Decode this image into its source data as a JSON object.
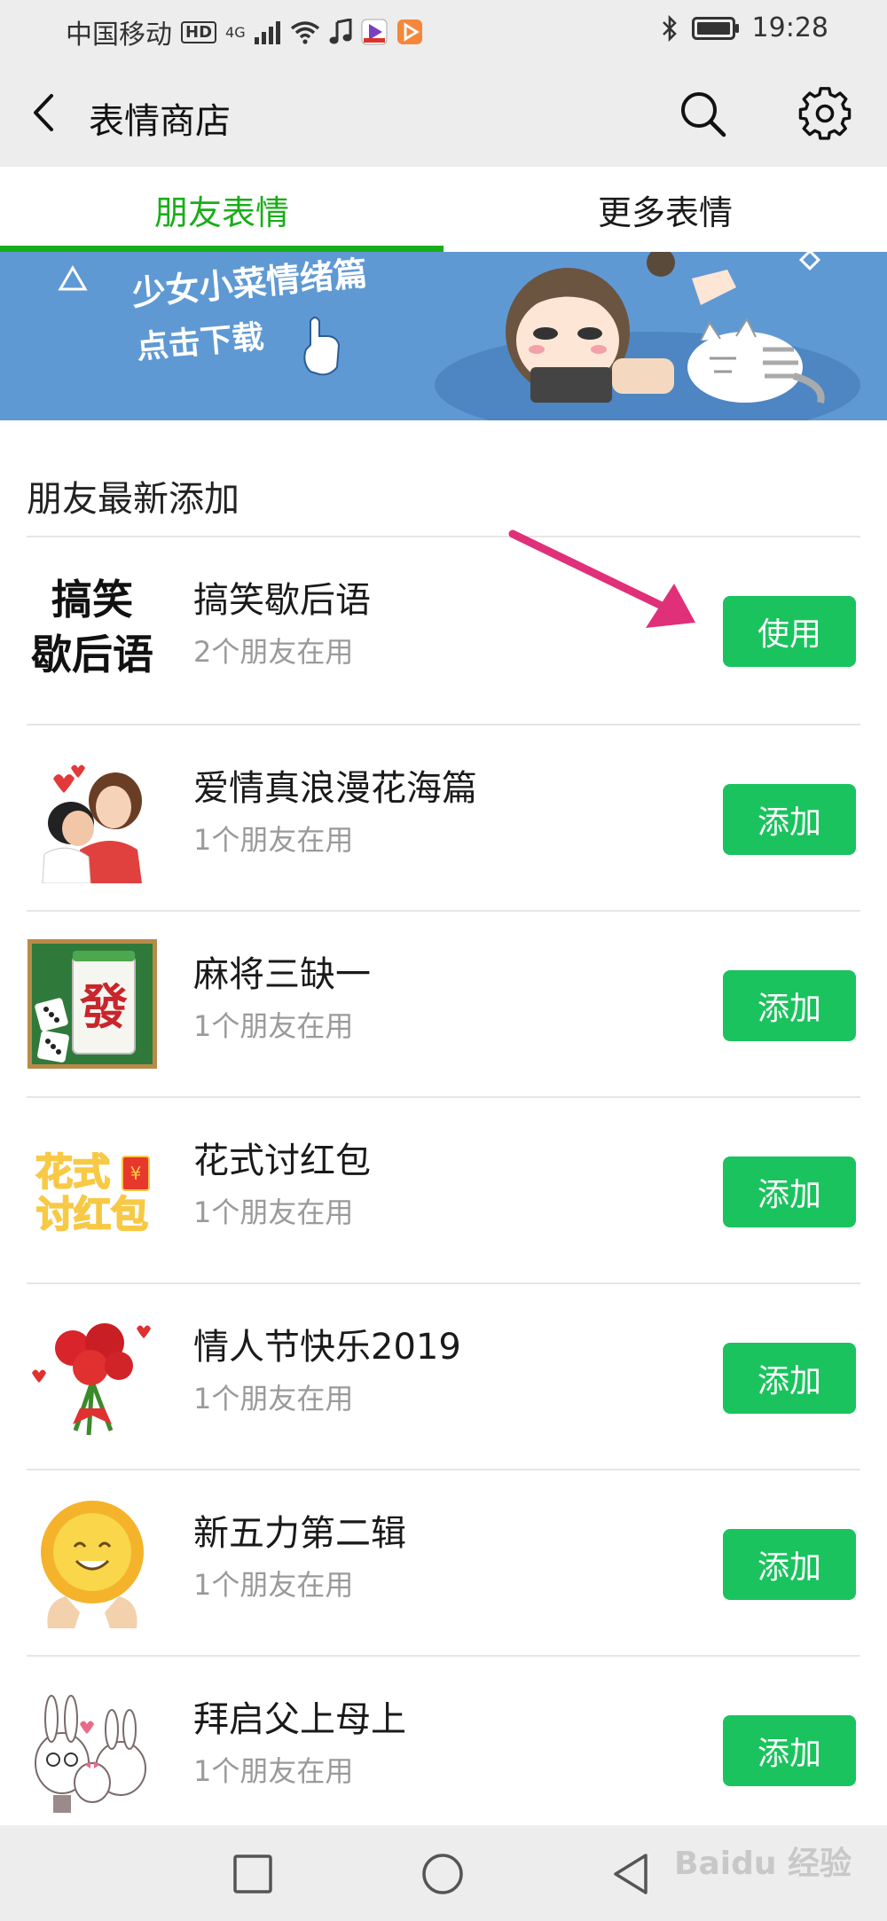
{
  "status_bar": {
    "carrier": "中国移动",
    "hd": "HD",
    "network": "4G",
    "time": "19:28",
    "icons": [
      "wifi-icon",
      "music-icon",
      "video-app-icon",
      "play-app-icon",
      "bluetooth-icon",
      "battery-icon"
    ]
  },
  "header": {
    "title": "表情商店",
    "icons": [
      "back-icon",
      "search-icon",
      "settings-icon"
    ]
  },
  "tabs": [
    {
      "label": "朋友表情",
      "active": true
    },
    {
      "label": "更多表情",
      "active": false
    }
  ],
  "banner": {
    "line1": "少女小菜情绪篇",
    "line2": "点击下载"
  },
  "section": {
    "title": "朋友最新添加"
  },
  "items": [
    {
      "name": "搞笑歇后语",
      "users": "2个朋友在用",
      "button": "使用",
      "thumb_text": "搞笑歇后语",
      "thumb_line1": "搞笑",
      "thumb_line2": "歇后语"
    },
    {
      "name": "爱情真浪漫花海篇",
      "users": "1个朋友在用",
      "button": "添加"
    },
    {
      "name": "麻将三缺一",
      "users": "1个朋友在用",
      "button": "添加",
      "thumb_text": "發"
    },
    {
      "name": "花式讨红包",
      "users": "1个朋友在用",
      "button": "添加",
      "thumb_line1": "花式",
      "thumb_line2": "讨红包",
      "thumb_badge": "¥"
    },
    {
      "name": "情人节快乐2019",
      "users": "1个朋友在用",
      "button": "添加"
    },
    {
      "name": "新五力第二辑",
      "users": "1个朋友在用",
      "button": "添加"
    },
    {
      "name": "拜启父上母上",
      "users": "1个朋友在用",
      "button": "添加"
    }
  ],
  "watermark": "Baidu 经验",
  "colors": {
    "accent": "#1aad19",
    "button": "#1ac35e",
    "arrow": "#e0307a",
    "banner": "#5f99d3"
  }
}
